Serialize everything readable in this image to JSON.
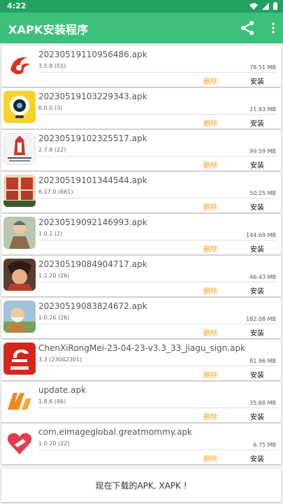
{
  "status": {
    "time": "4:22"
  },
  "appbar": {
    "title": "XAPK安装程序",
    "share_icon": "share-icon",
    "more_icon": "more-vert-icon"
  },
  "colors": {
    "primary": "#3cc07b",
    "primary_dark": "#22a160",
    "delete": "#f3a220"
  },
  "items": [
    {
      "name": "20230519110956486.apk",
      "version": "3.5.8 (51)",
      "size": "78.51 MB",
      "delete": "删除",
      "install": "安装",
      "icon": "phoenix-logo-icon"
    },
    {
      "name": "20230519103229343.apk",
      "version": "6.0.0 (3)",
      "size": "21.93 MB",
      "delete": "删除",
      "install": "安装",
      "icon": "yellow-eye-icon"
    },
    {
      "name": "20230519102325517.apk",
      "version": "2.7.8 (22)",
      "size": "99.59 MB",
      "delete": "删除",
      "install": "安装",
      "icon": "district-tower-icon"
    },
    {
      "name": "20230519101344544.apk",
      "version": "6.17.0 (661)",
      "size": "50.25 MB",
      "delete": "删除",
      "install": "安装",
      "icon": "game-zelda-icon"
    },
    {
      "name": "20230519092146993.apk",
      "version": "1.0.1 (2)",
      "size": "144.69 MB",
      "delete": "删除",
      "install": "安装",
      "icon": "warrior-game-icon"
    },
    {
      "name": "20230519084904717.apk",
      "version": "1.2.20 (26)",
      "size": "46.43 MB",
      "delete": "删除",
      "install": "安装",
      "icon": "hero-game-icon"
    },
    {
      "name": "20230519083824672.apk",
      "version": "1.0.26 (26)",
      "size": "182.08 MB",
      "delete": "删除",
      "install": "安装",
      "icon": "old-man-game-icon"
    },
    {
      "name": "ChenXiRongMei-23-04-23-v3.3_33_jiagu_sign.apk",
      "version": "3.3 (23042301)",
      "size": "81.96 MB",
      "delete": "删除",
      "install": "安装",
      "icon": "red-media-icon"
    },
    {
      "name": "update.apk",
      "version": "1.8.6 (86)",
      "size": "35.68 MB",
      "delete": "删除",
      "install": "安装",
      "icon": "orange-logo-icon"
    },
    {
      "name": "com.eimageglobal.greatmommy.apk",
      "version": "1.0.20 (22)",
      "size": "6.75 MB",
      "delete": "删除",
      "install": "安装",
      "icon": "heart-hand-icon"
    }
  ],
  "footer": {
    "text": "现在下载的APK, XAPK !"
  }
}
